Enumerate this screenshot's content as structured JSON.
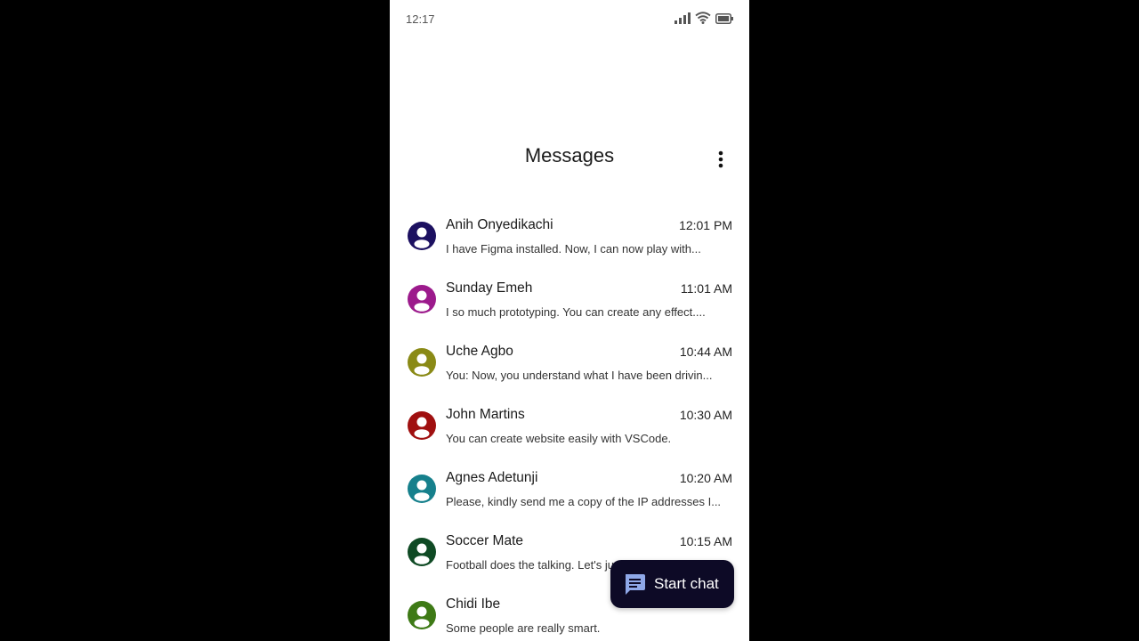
{
  "status_bar": {
    "time": "12:17",
    "icons": [
      "signal-icon",
      "wifi-icon",
      "battery-icon"
    ]
  },
  "header": {
    "title": "Messages",
    "menu_icon": "more-vertical-icon"
  },
  "conversations": [
    {
      "name": "Anih Onyedikachi",
      "time": "12:01 PM",
      "preview": "I have Figma installed. Now, I can now play with...",
      "avatar_color": "#1c1060"
    },
    {
      "name": "Sunday Emeh",
      "time": "11:01 AM",
      "preview": "I so much prototyping. You can create any effect....",
      "avatar_color": "#9c1a8c"
    },
    {
      "name": "Uche Agbo",
      "time": "10:44 AM",
      "preview": "You: Now, you understand what I have been drivin...",
      "avatar_color": "#8a8a16"
    },
    {
      "name": "John Martins",
      "time": "10:30 AM",
      "preview": "You can create website easily with VSCode.",
      "avatar_color": "#a01010"
    },
    {
      "name": "Agnes Adetunji",
      "time": "10:20 AM",
      "preview": "Please, kindly send me a copy of the IP addresses I...",
      "avatar_color": "#16808c"
    },
    {
      "name": "Soccer Mate",
      "time": "10:15 AM",
      "preview": "Football does the talking. Let's ju",
      "avatar_color": "#0f4a24"
    },
    {
      "name": "Chidi Ibe",
      "time": "",
      "preview": "Some people are really smart.",
      "avatar_color": "#3e7a16"
    }
  ],
  "fab": {
    "label": "Start chat",
    "icon": "chat-icon",
    "icon_color": "#8fa8e8"
  },
  "colors": {
    "background": "#000000",
    "surface": "#ffffff",
    "fab_background": "#0d0a26"
  }
}
